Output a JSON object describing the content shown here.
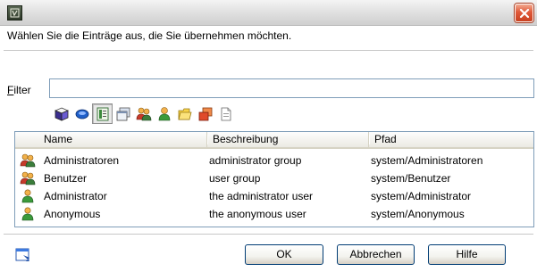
{
  "window": {
    "title": "",
    "accent": "#2f3a2a",
    "close_color": "#e0593a"
  },
  "instruction": "Wählen Sie die Einträge aus, die Sie übernehmen möchten.",
  "filter": {
    "label_accesskey": "F",
    "label_rest": "ilter",
    "value": "",
    "placeholder": ""
  },
  "type_toolbar": {
    "buttons": [
      {
        "icon": "box-icon",
        "pressed": false
      },
      {
        "icon": "disk-icon",
        "pressed": false
      },
      {
        "icon": "page-icon",
        "pressed": true
      },
      {
        "icon": "window-icon",
        "pressed": false
      },
      {
        "icon": "group-icon",
        "pressed": false
      },
      {
        "icon": "user-icon",
        "pressed": false
      },
      {
        "icon": "folder-icon",
        "pressed": false
      },
      {
        "icon": "copy-icon",
        "pressed": false
      },
      {
        "icon": "document-icon",
        "pressed": false
      }
    ]
  },
  "list": {
    "columns": [
      "Name",
      "Beschreibung",
      "Pfad"
    ],
    "rows": [
      {
        "icon": "group-icon",
        "name": "Administratoren",
        "description": "administrator group",
        "path": "system/Administratoren"
      },
      {
        "icon": "group-icon",
        "name": "Benutzer",
        "description": "user group",
        "path": "system/Benutzer"
      },
      {
        "icon": "user-icon",
        "name": "Administrator",
        "description": "the administrator user",
        "path": "system/Administrator"
      },
      {
        "icon": "user-icon",
        "name": "Anonymous",
        "description": "the anonymous user",
        "path": "system/Anonymous"
      }
    ]
  },
  "buttons": {
    "ok": "OK",
    "cancel": "Abbrechen",
    "help": "Hilfe",
    "help_icon": "help-window-icon"
  }
}
